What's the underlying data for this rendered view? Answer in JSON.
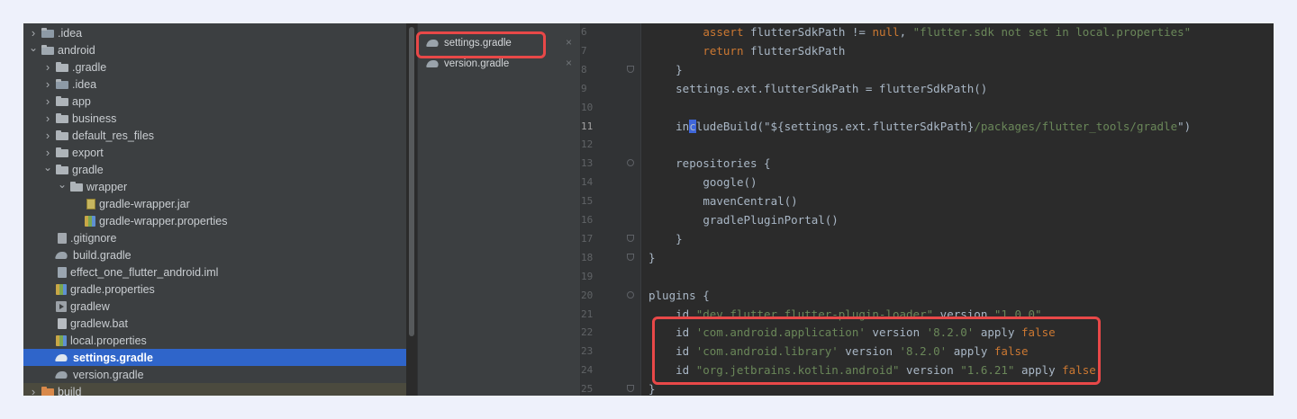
{
  "project_tree": {
    "items": [
      {
        "label": ".idea",
        "level": 0,
        "arrow": "right",
        "icon": "folder-idea"
      },
      {
        "label": "android",
        "level": 0,
        "arrow": "down",
        "icon": "folder-android"
      },
      {
        "label": ".gradle",
        "level": 1,
        "arrow": "right",
        "icon": "folder"
      },
      {
        "label": ".idea",
        "level": 1,
        "arrow": "right",
        "icon": "folder-idea"
      },
      {
        "label": "app",
        "level": 1,
        "arrow": "right",
        "icon": "folder"
      },
      {
        "label": "business",
        "level": 1,
        "arrow": "right",
        "icon": "folder"
      },
      {
        "label": "default_res_files",
        "level": 1,
        "arrow": "right",
        "icon": "folder"
      },
      {
        "label": "export",
        "level": 1,
        "arrow": "right",
        "icon": "folder"
      },
      {
        "label": "gradle",
        "level": 1,
        "arrow": "down",
        "icon": "folder"
      },
      {
        "label": "wrapper",
        "level": 2,
        "arrow": "down",
        "icon": "folder"
      },
      {
        "label": "gradle-wrapper.jar",
        "level": 3,
        "arrow": "none",
        "icon": "jar"
      },
      {
        "label": "gradle-wrapper.properties",
        "level": 3,
        "arrow": "none",
        "icon": "props"
      },
      {
        "label": ".gitignore",
        "level": 1,
        "arrow": "none",
        "icon": "gitignore"
      },
      {
        "label": "build.gradle",
        "level": 1,
        "arrow": "none",
        "icon": "gradle-elephant"
      },
      {
        "label": "effect_one_flutter_android.iml",
        "level": 1,
        "arrow": "none",
        "icon": "iml"
      },
      {
        "label": "gradle.properties",
        "level": 1,
        "arrow": "none",
        "icon": "props"
      },
      {
        "label": "gradlew",
        "level": 1,
        "arrow": "none",
        "icon": "exec"
      },
      {
        "label": "gradlew.bat",
        "level": 1,
        "arrow": "none",
        "icon": "file"
      },
      {
        "label": "local.properties",
        "level": 1,
        "arrow": "none",
        "icon": "props"
      },
      {
        "label": "settings.gradle",
        "level": 1,
        "arrow": "none",
        "icon": "gradle-elephant",
        "selected": true
      },
      {
        "label": "version.gradle",
        "level": 1,
        "arrow": "none",
        "icon": "gradle-elephant"
      },
      {
        "label": "build",
        "level": 0,
        "arrow": "right",
        "icon": "folder-build"
      }
    ]
  },
  "file_tabs": {
    "partial_top": "~~ ~ ~~~",
    "items": [
      {
        "label": "settings.gradle",
        "close": "×"
      },
      {
        "label": "version.gradle",
        "close": "×"
      }
    ]
  },
  "editor": {
    "lines": [
      {
        "num": "6",
        "indent": 8,
        "fold": "",
        "tokens": [
          [
            "kw",
            "assert "
          ],
          [
            "p",
            "flutterSdkPath != "
          ],
          [
            "kw",
            "null"
          ],
          [
            "p",
            ", "
          ],
          [
            "str",
            "\"flutter.sdk not set in local.properties\""
          ]
        ]
      },
      {
        "num": "7",
        "indent": 8,
        "fold": "",
        "tokens": [
          [
            "kw",
            "return "
          ],
          [
            "p",
            "flutterSdkPath"
          ]
        ]
      },
      {
        "num": "8",
        "indent": 4,
        "fold": "end",
        "tokens": [
          [
            "p",
            "}"
          ]
        ]
      },
      {
        "num": "9",
        "indent": 4,
        "fold": "",
        "tokens": [
          [
            "p",
            "settings.ext.flutterSdkPath = flutterSdkPath()"
          ]
        ]
      },
      {
        "num": "10",
        "indent": 0,
        "fold": "",
        "tokens": []
      },
      {
        "num": "11",
        "indent": 4,
        "fold": "",
        "current": true,
        "tokens": [
          [
            "p",
            "in"
          ],
          [
            "cursor",
            "c"
          ],
          [
            "p",
            "ludeBuild(\""
          ],
          [
            "p",
            "${settings.ext.flutterSdkPath}"
          ],
          [
            "str",
            "/packages/flutter_tools/gradle"
          ],
          [
            "p",
            "\")"
          ]
        ]
      },
      {
        "num": "12",
        "indent": 0,
        "fold": "",
        "tokens": []
      },
      {
        "num": "13",
        "indent": 4,
        "fold": "start",
        "tokens": [
          [
            "p",
            "repositories {"
          ]
        ]
      },
      {
        "num": "14",
        "indent": 8,
        "fold": "",
        "tokens": [
          [
            "p",
            "google()"
          ]
        ]
      },
      {
        "num": "15",
        "indent": 8,
        "fold": "",
        "tokens": [
          [
            "p",
            "mavenCentral()"
          ]
        ]
      },
      {
        "num": "16",
        "indent": 8,
        "fold": "",
        "tokens": [
          [
            "p",
            "gradlePluginPortal()"
          ]
        ]
      },
      {
        "num": "17",
        "indent": 4,
        "fold": "end",
        "tokens": [
          [
            "p",
            "}"
          ]
        ]
      },
      {
        "num": "18",
        "indent": 0,
        "fold": "end",
        "tokens": [
          [
            "p",
            "}"
          ]
        ]
      },
      {
        "num": "19",
        "indent": 0,
        "fold": "",
        "tokens": []
      },
      {
        "num": "20",
        "indent": 0,
        "fold": "start",
        "tokens": [
          [
            "p",
            "plugins {"
          ]
        ]
      },
      {
        "num": "21",
        "indent": 4,
        "fold": "",
        "tokens": [
          [
            "p",
            "id "
          ],
          [
            "str",
            "\"dev.flutter.flutter-plugin-loader\""
          ],
          [
            "p",
            " version "
          ],
          [
            "str",
            "\"1.0.0\""
          ]
        ]
      },
      {
        "num": "22",
        "indent": 4,
        "fold": "",
        "tokens": [
          [
            "p",
            "id "
          ],
          [
            "str",
            "'com.android.application'"
          ],
          [
            "p",
            " version "
          ],
          [
            "str",
            "'8.2.0'"
          ],
          [
            "p",
            " apply "
          ],
          [
            "kw",
            "false"
          ]
        ]
      },
      {
        "num": "23",
        "indent": 4,
        "fold": "",
        "tokens": [
          [
            "p",
            "id "
          ],
          [
            "str",
            "'com.android.library'"
          ],
          [
            "p",
            " version "
          ],
          [
            "str",
            "'8.2.0'"
          ],
          [
            "p",
            " apply "
          ],
          [
            "kw",
            "false"
          ]
        ]
      },
      {
        "num": "24",
        "indent": 4,
        "fold": "",
        "tokens": [
          [
            "p",
            "id "
          ],
          [
            "str",
            "\"org.jetbrains.kotlin.android\""
          ],
          [
            "p",
            " version "
          ],
          [
            "str",
            "\"1.6.21\""
          ],
          [
            "p",
            " apply "
          ],
          [
            "kw",
            "false"
          ]
        ]
      },
      {
        "num": "25",
        "indent": 0,
        "fold": "end",
        "tokens": [
          [
            "p",
            "}"
          ]
        ]
      }
    ]
  },
  "colors": {
    "keyword": "#cc7832",
    "string": "#6a8759",
    "plain": "#a9b7c6",
    "highlight_box": "#e84848",
    "selection": "#2f65ca"
  }
}
